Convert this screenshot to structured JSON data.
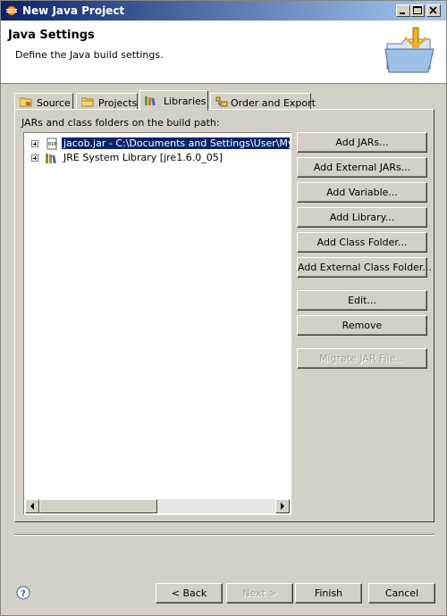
{
  "window": {
    "title": "New Java Project",
    "controls": {
      "minimize": "minimize-icon",
      "maximize": "maximize-icon",
      "close": "close-icon"
    }
  },
  "header": {
    "title": "Java Settings",
    "description": "Define the Java build settings."
  },
  "tabs": [
    {
      "label": "Source",
      "icon": "source-folder-icon",
      "active": false
    },
    {
      "label": "Projects",
      "icon": "projects-icon",
      "active": false
    },
    {
      "label": "Libraries",
      "icon": "libraries-icon",
      "active": true
    },
    {
      "label": "Order and Export",
      "icon": "order-export-icon",
      "active": false
    }
  ],
  "libraries": {
    "list_label": "JARs and class folders on the build path:",
    "entries": [
      {
        "label": "jacob.jar - C:\\Documents and Settings\\User\\My Docu",
        "icon": "jar-icon",
        "selected": true
      },
      {
        "label": "JRE System Library [jre1.6.0_05]",
        "icon": "jre-library-icon",
        "selected": false
      }
    ],
    "buttons": {
      "add_jars": "Add JARs...",
      "add_external_jars": "Add External JARs...",
      "add_variable": "Add Variable...",
      "add_library": "Add Library...",
      "add_class_folder": "Add Class Folder...",
      "add_external_class_folder": "Add External Class Folder...",
      "edit": "Edit...",
      "remove": "Remove",
      "migrate_jar": "Migrate JAR File..."
    }
  },
  "footer": {
    "back": "< Back",
    "next": "Next >",
    "finish": "Finish",
    "cancel": "Cancel",
    "help_icon": "help-icon"
  },
  "colors": {
    "titlebar_start": "#0a246a",
    "titlebar_end": "#a6caf0",
    "dialog_bg": "#d4d0c8",
    "selection": "#0a246a"
  }
}
